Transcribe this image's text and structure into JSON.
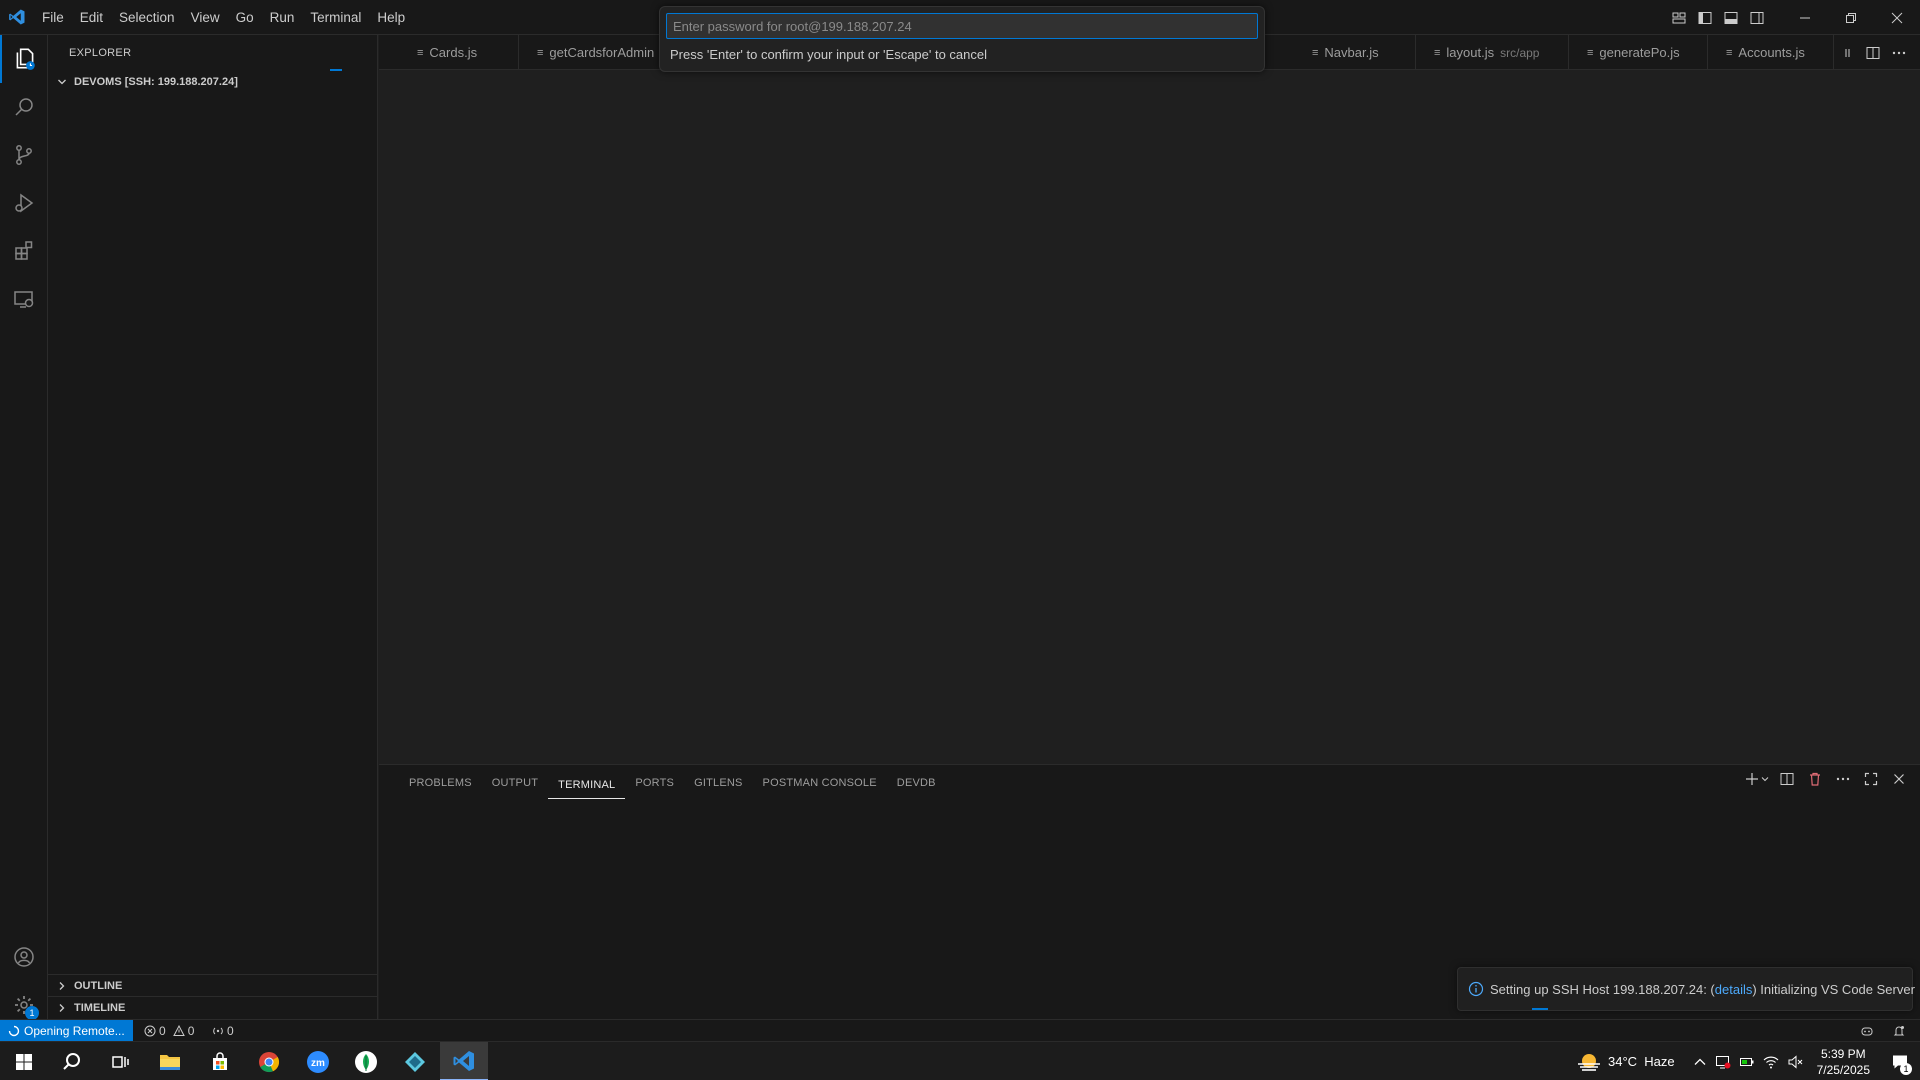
{
  "menu": [
    "File",
    "Edit",
    "Selection",
    "View",
    "Go",
    "Run",
    "Terminal",
    "Help"
  ],
  "sidebar": {
    "title": "EXPLORER",
    "root_folder": "DEVOMS [SSH: 199.188.207.24]",
    "sections": [
      "OUTLINE",
      "TIMELINE"
    ],
    "settings_badge": "1"
  },
  "tabs": [
    {
      "label": "Cards.js",
      "sub": ""
    },
    {
      "label": "getCardsforAdmin",
      "sub": ""
    },
    {
      "label": "Navbar.js",
      "sub": ""
    },
    {
      "label": "layout.js",
      "sub": "src/app"
    },
    {
      "label": "generatePo.js",
      "sub": ""
    },
    {
      "label": "Accounts.js",
      "sub": ""
    }
  ],
  "quick_input": {
    "placeholder": "Enter password for root@199.188.207.24",
    "hint": "Press 'Enter' to confirm your input or 'Escape' to cancel"
  },
  "panel": {
    "tabs": [
      "PROBLEMS",
      "OUTPUT",
      "TERMINAL",
      "PORTS",
      "GITLENS",
      "POSTMAN CONSOLE",
      "DEVDB"
    ],
    "active_tab": "TERMINAL"
  },
  "notification": {
    "prefix": "Setting up SSH Host 199.188.207.24: (",
    "link": "details",
    "suffix": ") Initializing VS Code Server"
  },
  "statusbar": {
    "remote": "Opening Remote...",
    "errors": "0",
    "warnings": "0",
    "ports": "0"
  },
  "taskbar": {
    "weather": "34°C  Haze",
    "time": "5:39 PM",
    "date": "7/25/2025",
    "notif_count": "1"
  },
  "colors": {
    "accent": "#0078d4",
    "link": "#4daafc"
  }
}
